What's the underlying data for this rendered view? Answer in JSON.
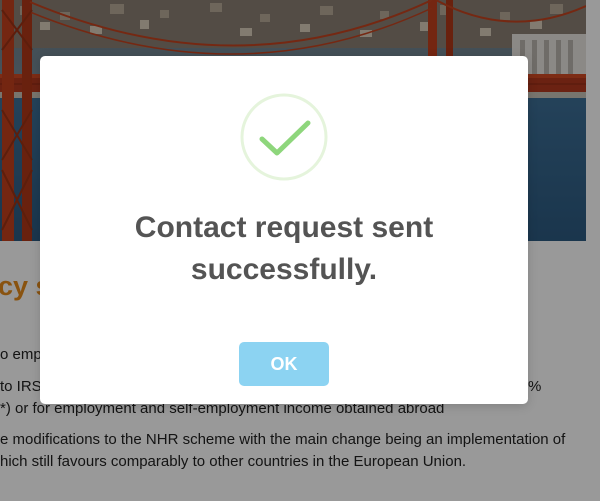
{
  "page": {
    "section_heading": "cy s",
    "paragraph_lines": [
      "o emp",
      "to IRS",
      "%",
      "*) or for employment and self-employment income obtained abroad",
      "e modifications to the NHR scheme with the main change being an implementation of",
      "hich still favours comparably to other countries in the European Union."
    ]
  },
  "modal": {
    "icon": "success-checkmark-icon",
    "title": "Contact request sent successfully.",
    "ok_label": "OK"
  },
  "colors": {
    "overlay": "rgba(0,0,0,0.40)",
    "heading_orange": "#e58a1c",
    "button_blue": "#8cd3f2",
    "check_green": "#8ed67c",
    "check_ring": "#e5f4dc",
    "title_gray": "#545454"
  }
}
